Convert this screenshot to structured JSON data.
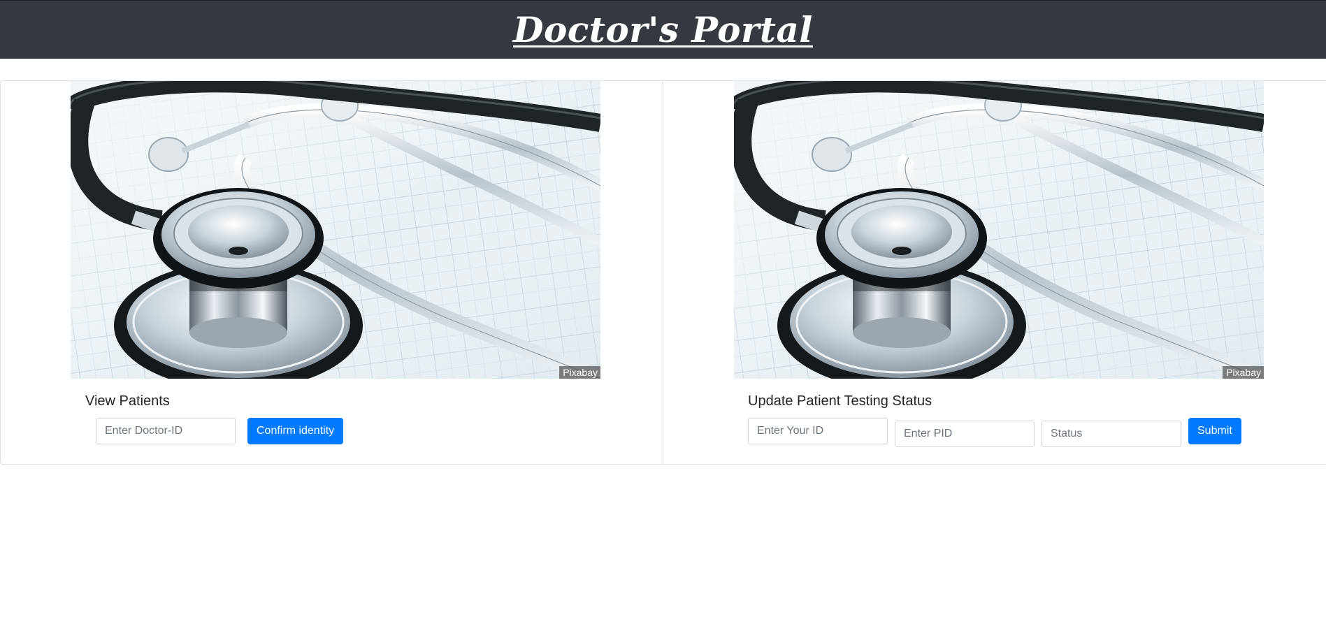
{
  "header": {
    "title": "Doctor's Portal"
  },
  "view_card": {
    "image_credit": "Pixabay",
    "title": "View Patients",
    "doctor_id_placeholder": "Enter Doctor-ID",
    "doctor_id_value": "",
    "confirm_label": "Confirm identity"
  },
  "update_card": {
    "image_credit": "Pixabay",
    "title": "Update Patient Testing Status",
    "your_id_placeholder": "Enter Your ID",
    "your_id_value": "",
    "pid_placeholder": "Enter PID",
    "pid_value": "",
    "status_placeholder": "Status",
    "status_value": "",
    "submit_label": "Submit"
  },
  "colors": {
    "header_bg": "#343a40",
    "primary": "#007bff",
    "border": "#dfdfdf"
  },
  "icons": {
    "card_image": "stethoscope-photo"
  }
}
